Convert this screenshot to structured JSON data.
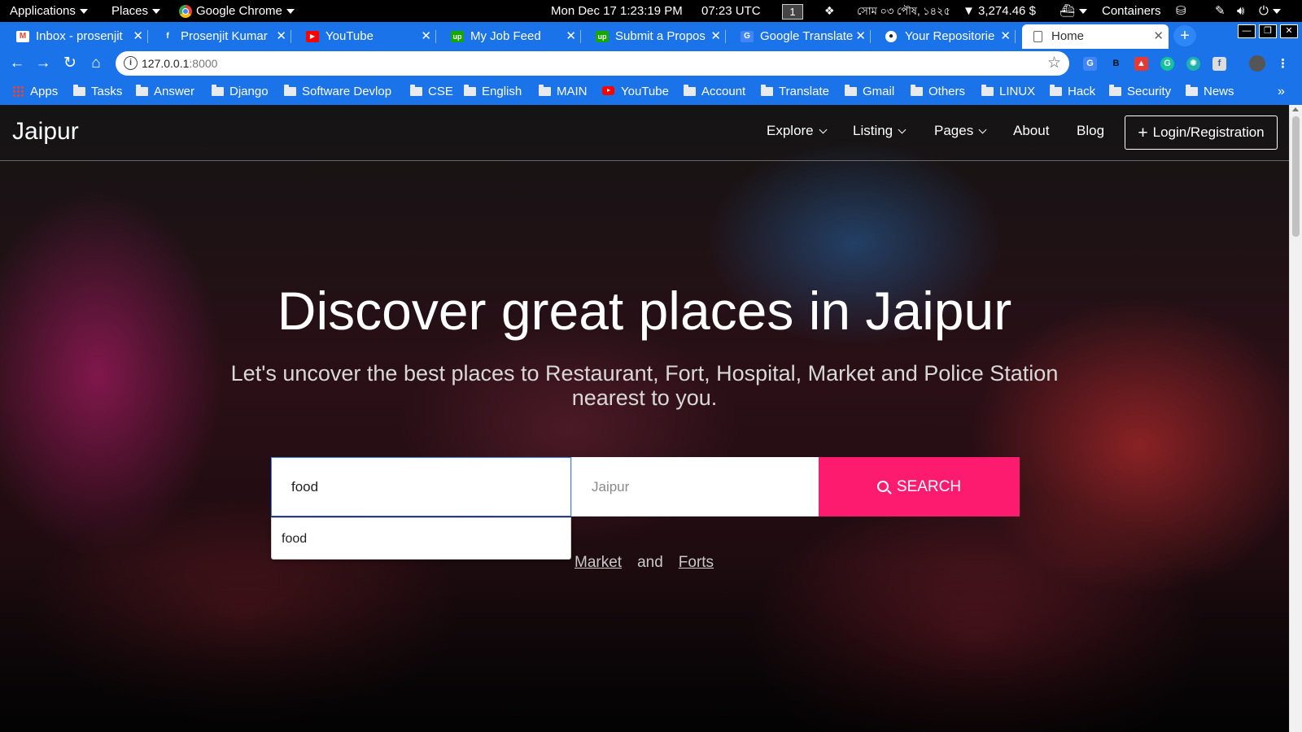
{
  "system_bar": {
    "applications": "Applications",
    "places": "Places",
    "active_app": "Google Chrome",
    "datetime": "Mon Dec 17  1:23:19 PM",
    "utc_time": "07:23 UTC",
    "workspace": "1",
    "bangla_date": "সোম ০৩ পৌষ, ১৪২৫",
    "balance": "▼ 3,274.46 $",
    "containers": "Containers"
  },
  "tabs": [
    {
      "title": "Inbox - prosenjit",
      "icon": "gmail-icon",
      "color": "#ea4335",
      "glyph": "M"
    },
    {
      "title": "Prosenjit Kumar",
      "icon": "facebook-icon",
      "color": "#1877f2",
      "glyph": "f"
    },
    {
      "title": "YouTube",
      "icon": "youtube-icon",
      "color": "#ff0000",
      "glyph": "▶"
    },
    {
      "title": "My Job Feed",
      "icon": "upwork-icon",
      "color": "#14a800",
      "glyph": "up"
    },
    {
      "title": "Submit a Propos",
      "icon": "upwork-icon",
      "color": "#14a800",
      "glyph": "up"
    },
    {
      "title": "Google Translate",
      "icon": "google-translate-icon",
      "color": "#4285f4",
      "glyph": "G"
    },
    {
      "title": "Your Repositorie",
      "icon": "github-icon",
      "color": "#24292e",
      "glyph": "●"
    },
    {
      "title": "Home",
      "icon": "page-icon",
      "color": "#ffffff",
      "glyph": "▯"
    }
  ],
  "address_bar": {
    "url_host": "127.0.0.1",
    "url_port": ":8000"
  },
  "bookmarks": [
    {
      "label": "Apps",
      "type": "apps"
    },
    {
      "label": "Tasks",
      "type": "folder"
    },
    {
      "label": "Answer",
      "type": "folder"
    },
    {
      "label": "Django",
      "type": "folder"
    },
    {
      "label": "Software Devlop",
      "type": "folder"
    },
    {
      "label": "CSE",
      "type": "folder"
    },
    {
      "label": "English",
      "type": "folder"
    },
    {
      "label": "MAIN",
      "type": "folder"
    },
    {
      "label": "YouTube",
      "type": "youtube"
    },
    {
      "label": "Account",
      "type": "folder"
    },
    {
      "label": "Translate",
      "type": "folder"
    },
    {
      "label": "Gmail",
      "type": "folder"
    },
    {
      "label": "Others",
      "type": "folder"
    },
    {
      "label": "LINUX",
      "type": "folder"
    },
    {
      "label": "Hack",
      "type": "folder"
    },
    {
      "label": "Security",
      "type": "folder"
    },
    {
      "label": "News",
      "type": "folder"
    }
  ],
  "site": {
    "brand": "Jaipur",
    "nav": [
      {
        "label": "Explore",
        "dropdown": true
      },
      {
        "label": "Listing",
        "dropdown": true
      },
      {
        "label": "Pages",
        "dropdown": true
      },
      {
        "label": "About",
        "dropdown": false
      },
      {
        "label": "Blog",
        "dropdown": false
      }
    ],
    "login_label": "Login/Registration",
    "hero_title": "Discover great places in Jaipur",
    "hero_subtitle": "Let's uncover the best places to Restaurant, Fort, Hospital, Market and Police Station nearest to you.",
    "search": {
      "what_value": "food",
      "where_placeholder": "Jaipur",
      "button_label": "SEARCH",
      "suggestion": "food"
    },
    "popular": {
      "link1": "Market",
      "and": "and",
      "link2": "Forts"
    }
  },
  "colors": {
    "chrome_blue": "#1a73e8",
    "search_button": "#fc1b6e"
  }
}
